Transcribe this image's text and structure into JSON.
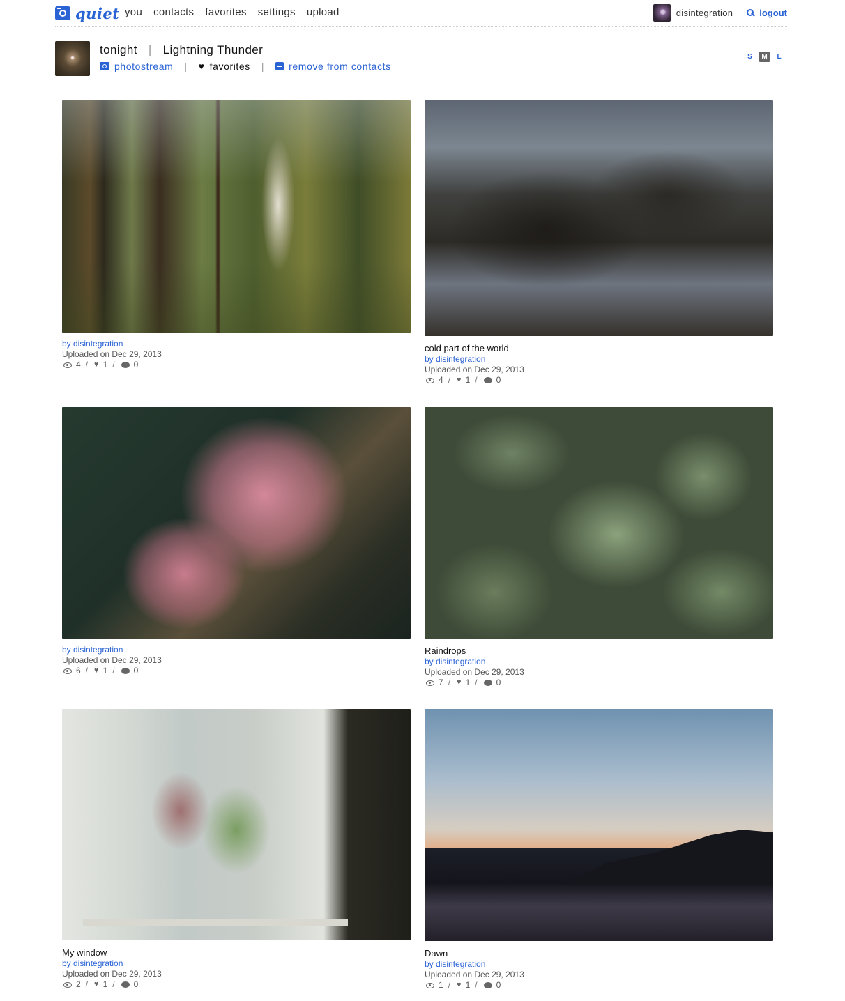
{
  "app": {
    "logo_text": "quiet",
    "brand_color": "#2a63d4"
  },
  "nav": [
    {
      "label": "you"
    },
    {
      "label": "contacts"
    },
    {
      "label": "favorites"
    },
    {
      "label": "settings"
    },
    {
      "label": "upload"
    }
  ],
  "user": {
    "name": "disintegration",
    "logout_label": "logout"
  },
  "profile": {
    "name": "tonight",
    "set_title": "Lightning Thunder",
    "separator": "|",
    "links": {
      "photostream": "photostream",
      "favorites": "favorites",
      "remove_contact": "remove from contacts"
    }
  },
  "size_toggle": {
    "small": "S",
    "medium": "M",
    "large": "L",
    "selected": "M"
  },
  "photos": [
    {
      "title": "",
      "by": "by disintegration",
      "uploaded": "Uploaded on Dec 29, 2013",
      "views": "4",
      "faves": "1",
      "comments": "0"
    },
    {
      "title": "cold part of the world",
      "by": "by disintegration",
      "uploaded": "Uploaded on Dec 29, 2013",
      "views": "4",
      "faves": "1",
      "comments": "0"
    },
    {
      "title": "",
      "by": "by disintegration",
      "uploaded": "Uploaded on Dec 29, 2013",
      "views": "6",
      "faves": "1",
      "comments": "0"
    },
    {
      "title": "Raindrops",
      "by": "by disintegration",
      "uploaded": "Uploaded on Dec 29, 2013",
      "views": "7",
      "faves": "1",
      "comments": "0"
    },
    {
      "title": "My window",
      "by": "by disintegration",
      "uploaded": "Uploaded on Dec 29, 2013",
      "views": "2",
      "faves": "1",
      "comments": "0"
    },
    {
      "title": "Dawn",
      "by": "by disintegration",
      "uploaded": "Uploaded on Dec 29, 2013",
      "views": "1",
      "faves": "1",
      "comments": "0"
    }
  ],
  "stat_separator": "/"
}
